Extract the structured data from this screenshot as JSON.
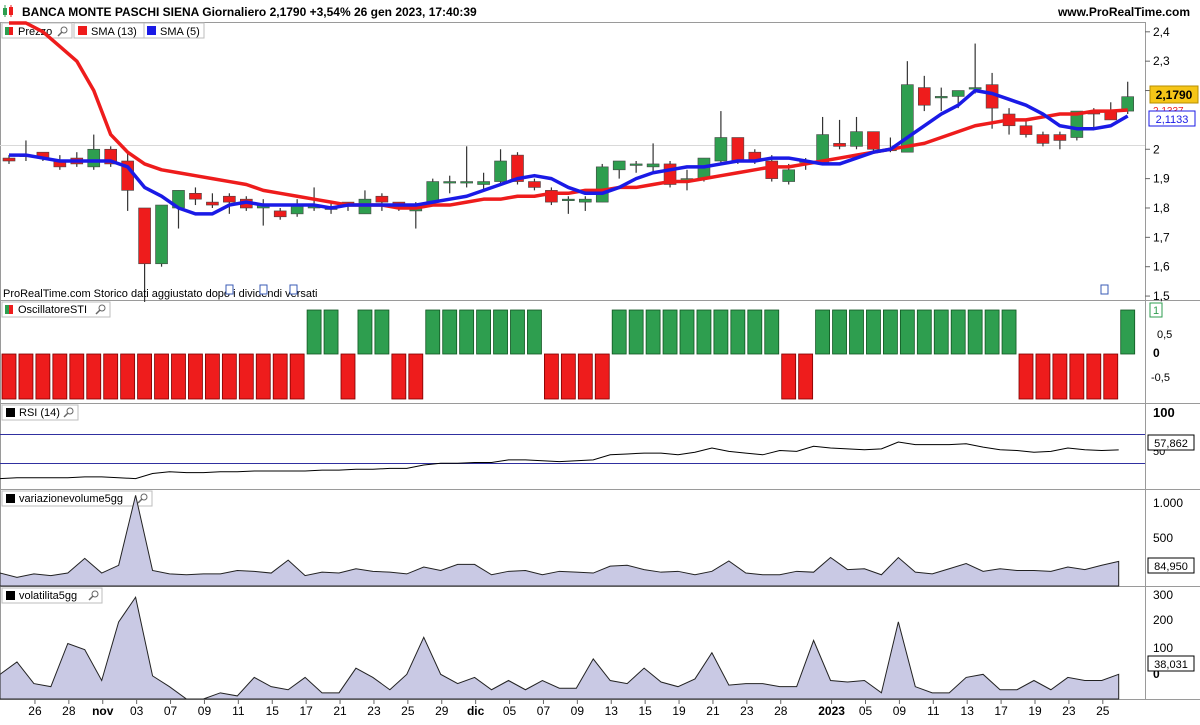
{
  "header": {
    "title": "BANCA MONTE PASCHI SIENA Giornaliero 2,1790 +3,54% 26 gen 2023, 17:40:39",
    "site": "www.ProRealTime.com"
  },
  "price_panel": {
    "legend": [
      {
        "label": "Prezzo",
        "color": "#2e9e4f",
        "icon": "candle-icon"
      },
      {
        "label": "SMA (13)",
        "color": "#ee1c1c",
        "icon": "square-icon"
      },
      {
        "label": "SMA (5)",
        "color": "#1a1ae6",
        "icon": "square-icon"
      }
    ],
    "last_price_label": "2,1790",
    "sma13_label": "2,1337",
    "sma5_label": "2,1133",
    "footer_note": "ProRealTime.com Storico dati aggiustato dopo i dividendi versati",
    "y_ticks": [
      "2,4",
      "2,3",
      "2,2",
      "2",
      "1,9",
      "1,8",
      "1,7",
      "1,6",
      "1,5"
    ]
  },
  "osc_panel": {
    "title": "OscillatoreSTI",
    "y_ticks": [
      "1",
      "0,5",
      "0",
      "-0,5"
    ]
  },
  "rsi_panel": {
    "title": "RSI (14)",
    "y_ticks": [
      "100",
      "50"
    ],
    "last_value": "57,862"
  },
  "vol_panel": {
    "title": "variazionevolume5gg",
    "y_ticks": [
      "1.000",
      "500",
      "0"
    ],
    "last_value": "84,950"
  },
  "volat_panel": {
    "title": "volatilita5gg",
    "y_ticks": [
      "300",
      "200",
      "100",
      "0"
    ],
    "last_value": "38,031"
  },
  "x_axis": {
    "labels": [
      "26",
      "28",
      "nov",
      "03",
      "07",
      "09",
      "11",
      "15",
      "17",
      "21",
      "23",
      "25",
      "29",
      "dic",
      "05",
      "07",
      "09",
      "13",
      "15",
      "19",
      "21",
      "23",
      "28",
      "2023",
      "05",
      "09",
      "11",
      "13",
      "17",
      "19",
      "23",
      "25"
    ]
  },
  "colors": {
    "up": "#2e9e4f",
    "down": "#ee1c1c",
    "sma13": "#ee1c1c",
    "sma5": "#1a1ae6",
    "last_price_bg": "#f5c518",
    "fill": "#c9c9e4"
  },
  "chart_data": [
    {
      "type": "candlestick",
      "ylim": [
        1.49,
        2.43
      ],
      "candles": [
        {
          "x": "25 ott",
          "o": 1.97,
          "h": 1.98,
          "l": 1.95,
          "c": 1.96
        },
        {
          "x": "26 ott",
          "o": 1.98,
          "h": 2.03,
          "l": 1.96,
          "c": 1.98
        },
        {
          "x": "27 ott",
          "o": 1.99,
          "h": 1.99,
          "l": 1.96,
          "c": 1.97
        },
        {
          "x": "28 ott",
          "o": 1.96,
          "h": 1.98,
          "l": 1.93,
          "c": 1.94
        },
        {
          "x": "31 ott",
          "o": 1.97,
          "h": 1.99,
          "l": 1.94,
          "c": 1.95
        },
        {
          "x": "01 nov",
          "o": 1.94,
          "h": 2.05,
          "l": 1.93,
          "c": 2.0
        },
        {
          "x": "02 nov",
          "o": 2.0,
          "h": 2.01,
          "l": 1.94,
          "c": 1.95
        },
        {
          "x": "03 nov",
          "o": 1.96,
          "h": 1.99,
          "l": 1.79,
          "c": 1.86
        },
        {
          "x": "04 nov",
          "o": 1.8,
          "h": 1.8,
          "l": 1.48,
          "c": 1.61
        },
        {
          "x": "07 nov",
          "o": 1.61,
          "h": 1.81,
          "l": 1.6,
          "c": 1.81
        },
        {
          "x": "08 nov",
          "o": 1.8,
          "h": 1.86,
          "l": 1.73,
          "c": 1.86
        },
        {
          "x": "09 nov",
          "o": 1.85,
          "h": 1.87,
          "l": 1.81,
          "c": 1.83
        },
        {
          "x": "10 nov",
          "o": 1.82,
          "h": 1.85,
          "l": 1.8,
          "c": 1.81
        },
        {
          "x": "11 nov",
          "o": 1.84,
          "h": 1.85,
          "l": 1.78,
          "c": 1.82
        },
        {
          "x": "14 nov",
          "o": 1.83,
          "h": 1.84,
          "l": 1.79,
          "c": 1.8
        },
        {
          "x": "15 nov",
          "o": 1.8,
          "h": 1.83,
          "l": 1.74,
          "c": 1.81
        },
        {
          "x": "16 nov",
          "o": 1.79,
          "h": 1.8,
          "l": 1.76,
          "c": 1.77
        },
        {
          "x": "17 nov",
          "o": 1.78,
          "h": 1.83,
          "l": 1.77,
          "c": 1.81
        },
        {
          "x": "18 nov",
          "o": 1.8,
          "h": 1.87,
          "l": 1.79,
          "c": 1.81
        },
        {
          "x": "21 nov",
          "o": 1.8,
          "h": 1.82,
          "l": 1.78,
          "c": 1.8
        },
        {
          "x": "22 nov",
          "o": 1.82,
          "h": 1.82,
          "l": 1.79,
          "c": 1.81
        },
        {
          "x": "23 nov",
          "o": 1.78,
          "h": 1.86,
          "l": 1.78,
          "c": 1.83
        },
        {
          "x": "24 nov",
          "o": 1.84,
          "h": 1.85,
          "l": 1.79,
          "c": 1.82
        },
        {
          "x": "25 nov",
          "o": 1.82,
          "h": 1.82,
          "l": 1.79,
          "c": 1.8
        },
        {
          "x": "28 nov",
          "o": 1.79,
          "h": 1.82,
          "l": 1.73,
          "c": 1.81
        },
        {
          "x": "29 nov",
          "o": 1.82,
          "h": 1.9,
          "l": 1.81,
          "c": 1.89
        },
        {
          "x": "30 nov",
          "o": 1.89,
          "h": 1.91,
          "l": 1.85,
          "c": 1.89
        },
        {
          "x": "01 dic",
          "o": 1.89,
          "h": 2.01,
          "l": 1.87,
          "c": 1.89
        },
        {
          "x": "02 dic",
          "o": 1.88,
          "h": 1.92,
          "l": 1.86,
          "c": 1.89
        },
        {
          "x": "05 dic",
          "o": 1.89,
          "h": 2.0,
          "l": 1.88,
          "c": 1.96
        },
        {
          "x": "06 dic",
          "o": 1.98,
          "h": 1.99,
          "l": 1.88,
          "c": 1.89
        },
        {
          "x": "07 dic",
          "o": 1.89,
          "h": 1.9,
          "l": 1.86,
          "c": 1.87
        },
        {
          "x": "08 dic",
          "o": 1.86,
          "h": 1.87,
          "l": 1.81,
          "c": 1.82
        },
        {
          "x": "09 dic",
          "o": 1.83,
          "h": 1.84,
          "l": 1.78,
          "c": 1.83
        },
        {
          "x": "12 dic",
          "o": 1.82,
          "h": 1.84,
          "l": 1.79,
          "c": 1.83
        },
        {
          "x": "13 dic",
          "o": 1.82,
          "h": 1.95,
          "l": 1.82,
          "c": 1.94
        },
        {
          "x": "14 dic",
          "o": 1.93,
          "h": 1.96,
          "l": 1.9,
          "c": 1.96
        },
        {
          "x": "15 dic",
          "o": 1.95,
          "h": 1.96,
          "l": 1.92,
          "c": 1.95
        },
        {
          "x": "16 dic",
          "o": 1.94,
          "h": 2.02,
          "l": 1.92,
          "c": 1.95
        },
        {
          "x": "19 dic",
          "o": 1.95,
          "h": 1.96,
          "l": 1.87,
          "c": 1.88
        },
        {
          "x": "20 dic",
          "o": 1.89,
          "h": 1.93,
          "l": 1.86,
          "c": 1.9
        },
        {
          "x": "21 dic",
          "o": 1.9,
          "h": 1.97,
          "l": 1.89,
          "c": 1.97
        },
        {
          "x": "22 dic",
          "o": 1.96,
          "h": 2.13,
          "l": 1.95,
          "c": 2.04
        },
        {
          "x": "23 dic",
          "o": 2.04,
          "h": 2.04,
          "l": 1.95,
          "c": 1.96
        },
        {
          "x": "27 dic",
          "o": 1.99,
          "h": 2.0,
          "l": 1.95,
          "c": 1.96
        },
        {
          "x": "28 dic",
          "o": 1.96,
          "h": 1.98,
          "l": 1.89,
          "c": 1.9
        },
        {
          "x": "29 dic",
          "o": 1.89,
          "h": 1.95,
          "l": 1.88,
          "c": 1.93
        },
        {
          "x": "30 dic",
          "o": 1.96,
          "h": 1.97,
          "l": 1.93,
          "c": 1.96
        },
        {
          "x": "02 gen",
          "o": 1.95,
          "h": 2.11,
          "l": 1.95,
          "c": 2.05
        },
        {
          "x": "03 gen",
          "o": 2.02,
          "h": 2.1,
          "l": 2.0,
          "c": 2.01
        },
        {
          "x": "04 gen",
          "o": 2.01,
          "h": 2.11,
          "l": 2.0,
          "c": 2.06
        },
        {
          "x": "05 gen",
          "o": 2.06,
          "h": 2.06,
          "l": 1.99,
          "c": 2.0
        },
        {
          "x": "06 gen",
          "o": 2.0,
          "h": 2.04,
          "l": 1.99,
          "c": 2.0
        },
        {
          "x": "09 gen",
          "o": 1.99,
          "h": 2.3,
          "l": 1.99,
          "c": 2.22
        },
        {
          "x": "10 gen",
          "o": 2.21,
          "h": 2.25,
          "l": 2.13,
          "c": 2.15
        },
        {
          "x": "11 gen",
          "o": 2.18,
          "h": 2.21,
          "l": 2.13,
          "c": 2.18
        },
        {
          "x": "12 gen",
          "o": 2.18,
          "h": 2.2,
          "l": 2.14,
          "c": 2.2
        },
        {
          "x": "13 gen",
          "o": 2.21,
          "h": 2.36,
          "l": 2.19,
          "c": 2.21
        },
        {
          "x": "16 gen",
          "o": 2.22,
          "h": 2.26,
          "l": 2.07,
          "c": 2.14
        },
        {
          "x": "17 gen",
          "o": 2.12,
          "h": 2.14,
          "l": 2.05,
          "c": 2.08
        },
        {
          "x": "18 gen",
          "o": 2.08,
          "h": 2.1,
          "l": 2.04,
          "c": 2.05
        },
        {
          "x": "19 gen",
          "o": 2.05,
          "h": 2.06,
          "l": 2.01,
          "c": 2.02
        },
        {
          "x": "20 gen",
          "o": 2.05,
          "h": 2.06,
          "l": 2.0,
          "c": 2.03
        },
        {
          "x": "23 gen",
          "o": 2.04,
          "h": 2.13,
          "l": 2.03,
          "c": 2.13
        },
        {
          "x": "24 gen",
          "o": 2.13,
          "h": 2.14,
          "l": 2.07,
          "c": 2.12
        },
        {
          "x": "25 gen",
          "o": 2.13,
          "h": 2.16,
          "l": 2.1,
          "c": 2.1
        },
        {
          "x": "26 gen",
          "o": 2.13,
          "h": 2.23,
          "l": 2.12,
          "c": 2.179
        }
      ],
      "series": [
        {
          "name": "SMA (13)",
          "values": [
            2.5,
            2.45,
            2.4,
            2.35,
            2.3,
            2.2,
            2.05,
            1.99,
            1.95,
            1.93,
            1.92,
            1.91,
            1.9,
            1.89,
            1.88,
            1.86,
            1.85,
            1.84,
            1.83,
            1.82,
            1.81,
            1.81,
            1.81,
            1.8,
            1.8,
            1.81,
            1.81,
            1.82,
            1.83,
            1.83,
            1.84,
            1.84,
            1.85,
            1.85,
            1.86,
            1.86,
            1.87,
            1.87,
            1.88,
            1.89,
            1.89,
            1.9,
            1.91,
            1.92,
            1.93,
            1.94,
            1.94,
            1.95,
            1.96,
            1.97,
            1.98,
            1.99,
            2.0,
            2.01,
            2.02,
            2.04,
            2.06,
            2.08,
            2.09,
            2.1,
            2.1,
            2.11,
            2.12,
            2.12,
            2.13,
            2.13,
            2.1337
          ]
        },
        {
          "name": "SMA (5)",
          "values": [
            1.98,
            1.98,
            1.97,
            1.96,
            1.96,
            1.96,
            1.96,
            1.94,
            1.87,
            1.84,
            1.8,
            1.78,
            1.78,
            1.81,
            1.82,
            1.81,
            1.81,
            1.81,
            1.81,
            1.8,
            1.81,
            1.81,
            1.81,
            1.81,
            1.81,
            1.82,
            1.83,
            1.84,
            1.86,
            1.88,
            1.9,
            1.91,
            1.9,
            1.87,
            1.85,
            1.85,
            1.87,
            1.9,
            1.92,
            1.93,
            1.94,
            1.94,
            1.95,
            1.96,
            1.96,
            1.97,
            1.97,
            1.96,
            1.95,
            1.95,
            1.97,
            1.99,
            2.0,
            2.04,
            2.08,
            2.12,
            2.15,
            2.2,
            2.19,
            2.17,
            2.15,
            2.12,
            2.08,
            2.07,
            2.07,
            2.08,
            2.1133
          ]
        }
      ]
    },
    {
      "type": "bar",
      "name": "OscillatoreSTI",
      "ylim": [
        -1,
        1
      ],
      "values": [
        -1,
        -1,
        -1,
        -1,
        -1,
        -1,
        -1,
        -1,
        -1,
        -1,
        -1,
        -1,
        -1,
        -1,
        -1,
        -1,
        -1,
        -1,
        1,
        1,
        -1,
        1,
        1,
        -1,
        -1,
        1,
        1,
        1,
        1,
        1,
        1,
        1,
        -1,
        -1,
        -1,
        -1,
        1,
        1,
        1,
        1,
        1,
        1,
        1,
        1,
        1,
        1,
        -1,
        -1,
        1,
        1,
        1,
        1,
        1,
        1,
        1,
        1,
        1,
        1,
        1,
        1,
        -1,
        -1,
        -1,
        -1,
        -1,
        -1,
        1
      ]
    },
    {
      "type": "line",
      "name": "RSI (14)",
      "ylim": [
        0,
        100
      ],
      "reference_lines": [
        70,
        30
      ],
      "values": [
        24,
        25,
        25,
        25,
        25,
        26,
        26,
        25,
        24,
        30,
        32,
        31,
        31,
        32,
        32,
        33,
        33,
        33,
        33,
        34,
        34,
        35,
        35,
        36,
        36,
        40,
        42,
        42,
        43,
        43,
        46,
        46,
        45,
        44,
        45,
        46,
        52,
        53,
        54,
        54,
        52,
        55,
        60,
        56,
        54,
        52,
        57,
        56,
        62,
        60,
        59,
        58,
        59,
        67,
        64,
        64,
        64,
        65,
        61,
        58,
        57,
        55,
        56,
        60,
        58,
        57,
        57.862
      ]
    },
    {
      "type": "area",
      "name": "variazionevolume5gg",
      "ylim": [
        0,
        1100
      ],
      "values": [
        150,
        100,
        140,
        120,
        150,
        320,
        150,
        240,
        1050,
        180,
        140,
        130,
        140,
        140,
        180,
        170,
        150,
        300,
        120,
        160,
        150,
        200,
        170,
        160,
        140,
        220,
        180,
        250,
        250,
        130,
        170,
        180,
        130,
        170,
        160,
        150,
        230,
        240,
        190,
        160,
        170,
        130,
        170,
        290,
        150,
        130,
        130,
        170,
        160,
        330,
        190,
        200,
        130,
        330,
        160,
        140,
        200,
        260,
        170,
        200,
        180,
        180,
        170,
        220,
        190,
        240,
        284.95
      ]
    },
    {
      "type": "area",
      "name": "volatilita5gg",
      "ylim": [
        -40,
        320
      ],
      "values": [
        40,
        80,
        10,
        0,
        140,
        120,
        20,
        210,
        290,
        35,
        0,
        -40,
        -40,
        -20,
        -30,
        30,
        0,
        -10,
        30,
        -20,
        -20,
        60,
        30,
        -10,
        40,
        160,
        40,
        10,
        30,
        -10,
        20,
        -10,
        20,
        -5,
        -5,
        90,
        20,
        10,
        60,
        15,
        0,
        25,
        110,
        5,
        10,
        10,
        0,
        0,
        150,
        20,
        15,
        20,
        -20,
        210,
        0,
        -20,
        -20,
        30,
        40,
        -10,
        -10,
        20,
        -10,
        30,
        20,
        20,
        40
      ]
    }
  ]
}
